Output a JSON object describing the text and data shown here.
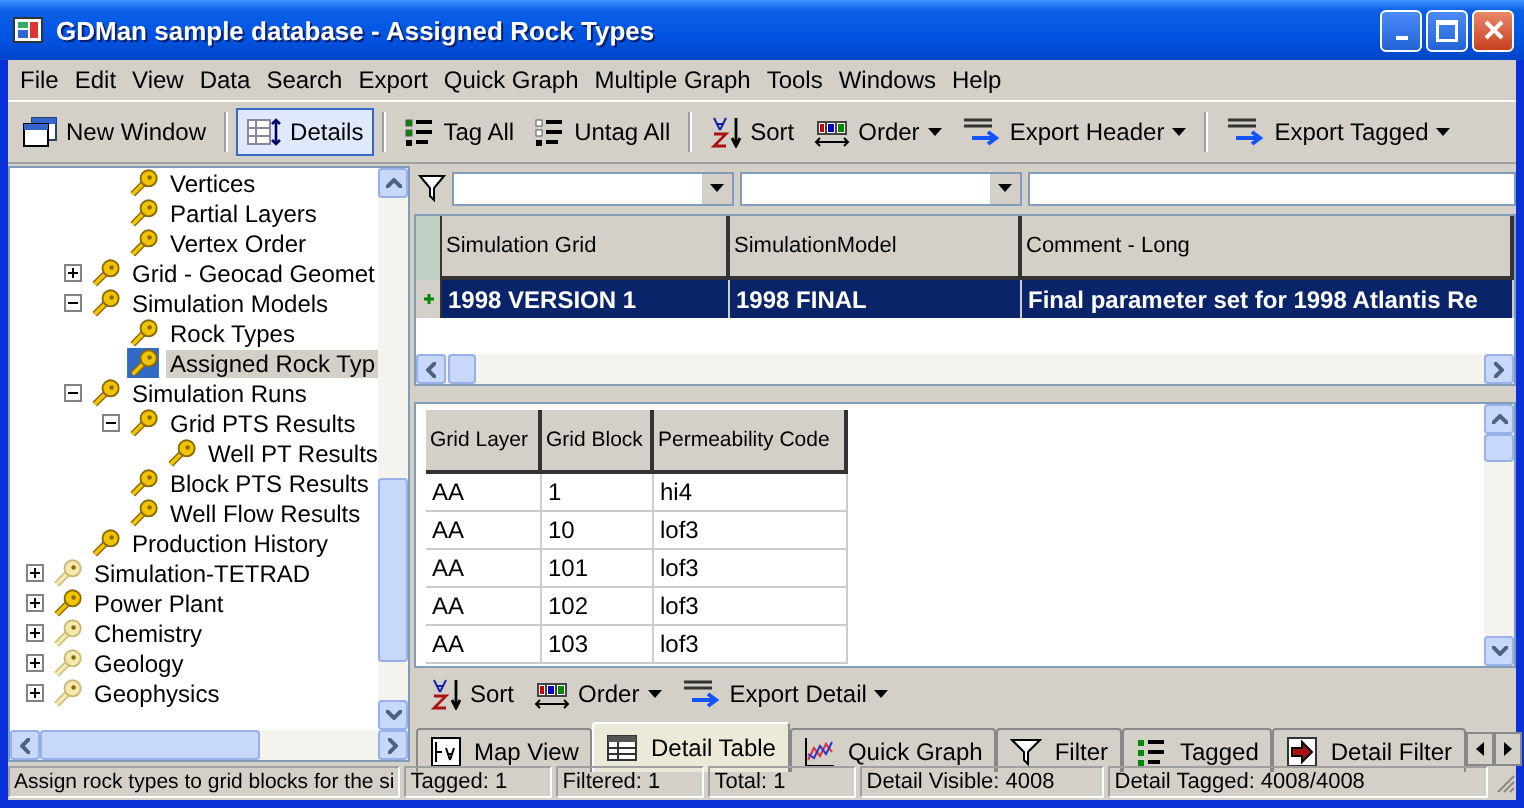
{
  "window": {
    "title": "GDMan sample database - Assigned Rock Types"
  },
  "menu": [
    "File",
    "Edit",
    "View",
    "Data",
    "Search",
    "Export",
    "Quick Graph",
    "Multiple Graph",
    "Tools",
    "Windows",
    "Help"
  ],
  "toolbar": [
    [
      {
        "label": "New Window",
        "kind": "window",
        "selected": false
      }
    ],
    [
      {
        "label": "Details",
        "kind": "details",
        "selected": true
      }
    ],
    [
      {
        "label": "Tag All",
        "kind": "tag",
        "selected": false
      },
      {
        "label": "Untag All",
        "kind": "untag",
        "selected": false
      }
    ],
    [
      {
        "label": "Sort",
        "kind": "sort",
        "selected": false
      },
      {
        "label": "Order",
        "kind": "order",
        "dropdown": true,
        "selected": false
      },
      {
        "label": "Export Header",
        "kind": "csv",
        "dropdown": true,
        "selected": false
      }
    ],
    [
      {
        "label": "Export Tagged",
        "kind": "csv",
        "dropdown": true,
        "selected": false
      }
    ]
  ],
  "tree": {
    "items": [
      {
        "children": [
          {
            "children": [
              {
                "label": "Vertices",
                "dimmed": false,
                "selected": false
              },
              {
                "label": "Partial Layers",
                "dimmed": false,
                "selected": false
              },
              {
                "label": "Vertex Order",
                "dimmed": false,
                "selected": false
              }
            ]
          },
          {
            "label": "Grid - Geocad Geomet",
            "expanded": false,
            "dimmed": false,
            "selected": false
          },
          {
            "label": "Simulation Models",
            "expanded": true,
            "dimmed": false,
            "selected": false,
            "children": [
              {
                "label": "Rock Types",
                "dimmed": false,
                "selected": false
              },
              {
                "label": "Assigned Rock Typ",
                "dimmed": false,
                "selected": true
              }
            ]
          },
          {
            "label": "Simulation Runs",
            "expanded": true,
            "dimmed": false,
            "selected": false,
            "children": [
              {
                "label": "Grid PTS Results",
                "expanded": true,
                "dimmed": false,
                "selected": false,
                "children": [
                  {
                    "label": "Well PT Results",
                    "dimmed": false,
                    "selected": false
                  }
                ]
              },
              {
                "label": "Block PTS Results",
                "dimmed": false,
                "selected": false
              },
              {
                "label": "Well Flow Results",
                "dimmed": false,
                "selected": false
              }
            ]
          },
          {
            "label": "Production History",
            "dimmed": false,
            "selected": false
          }
        ]
      },
      {
        "label": "Simulation-TETRAD",
        "expanded": false,
        "dimmed": true,
        "selected": false
      },
      {
        "label": "Power Plant",
        "expanded": false,
        "dimmed": false,
        "selected": false
      },
      {
        "label": "Chemistry",
        "expanded": false,
        "dimmed": true,
        "selected": false
      },
      {
        "label": "Geology",
        "expanded": false,
        "dimmed": true,
        "selected": false
      },
      {
        "label": "Geophysics",
        "expanded": false,
        "dimmed": true,
        "selected": false
      }
    ]
  },
  "filters": [
    {
      "kind": "dropdown"
    },
    {
      "kind": "dropdown"
    },
    {
      "kind": "text"
    }
  ],
  "master_table": {
    "columns": [
      "Simulation Grid",
      "SimulationModel",
      "Comment - Long"
    ],
    "rows": [
      {
        "cells": [
          "1998 VERSION 1",
          "1998 FINAL",
          "Final parameter set for 1998 Atlantis Re"
        ],
        "selected": true
      }
    ]
  },
  "detail_table": {
    "columns": [
      "Grid Layer",
      "Grid Block",
      "Permeability Code"
    ],
    "rows": [
      [
        "AA",
        "1",
        "hi4"
      ],
      [
        "AA",
        "10",
        "lof3"
      ],
      [
        "AA",
        "101",
        "lof3"
      ],
      [
        "AA",
        "102",
        "lof3"
      ],
      [
        "AA",
        "103",
        "lof3"
      ]
    ]
  },
  "detail_toolbar": [
    {
      "label": "Sort",
      "kind": "sort"
    },
    {
      "label": "Order",
      "kind": "order",
      "dropdown": true
    },
    {
      "label": "Export Detail",
      "kind": "csv",
      "dropdown": true
    }
  ],
  "tabs": [
    {
      "label": "Map View",
      "kind": "map",
      "selected": false
    },
    {
      "label": "Detail Table",
      "kind": "table",
      "selected": true
    },
    {
      "label": "Quick Graph",
      "kind": "chart",
      "selected": false
    },
    {
      "label": "Filter",
      "kind": "filter",
      "selected": false
    },
    {
      "label": "Tagged",
      "kind": "tag",
      "selected": false
    },
    {
      "label": "Detail Filter",
      "kind": "arrow",
      "selected": false
    }
  ],
  "status_bar": {
    "hint": "Assign rock types to grid blocks for the si",
    "fields": [
      "Tagged: 1",
      "Filtered: 1",
      "Total: 1",
      "Detail Visible: 4008",
      "Detail Tagged: 4008/4008"
    ]
  }
}
